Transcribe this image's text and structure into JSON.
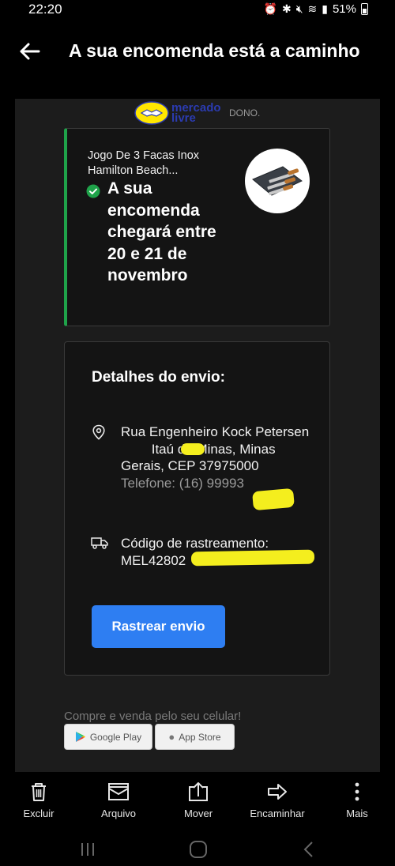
{
  "status_bar": {
    "time": "22:20",
    "battery": "51%"
  },
  "app_bar": {
    "title": "A sua encomenda está a caminho"
  },
  "email": {
    "logo_text_1": "mercado",
    "logo_text_2": "livre",
    "logo_tag": "DONO.",
    "order": {
      "product_name": "Jogo De 3 Facas Inox Hamilton Beach...",
      "eta": "A sua encomenda chegará entre 20 e 21 de novembro"
    },
    "details": {
      "title": "Detalhes do envio:",
      "address_1": "Rua Engenheiro Kock Petersen",
      "address_2": "Itaú de Minas, Minas Gerais, CEP 37975000",
      "phone": "Telefone: (16) 99993",
      "tracking_label": "Código de rastreamento:",
      "tracking_code": "MEL42802",
      "track_button": "Rastrear envio"
    },
    "promo_text": "Compre e venda pelo seu celular!",
    "google_play": "Google Play",
    "app_store": "App Store"
  },
  "actions": {
    "delete": "Excluir",
    "archive": "Arquivo",
    "move": "Mover",
    "forward": "Encaminhar",
    "more": "Mais"
  },
  "colors": {
    "accent_green": "#1fa34a",
    "button_blue": "#2e7ef2",
    "redaction_yellow": "#f4ee1e"
  }
}
